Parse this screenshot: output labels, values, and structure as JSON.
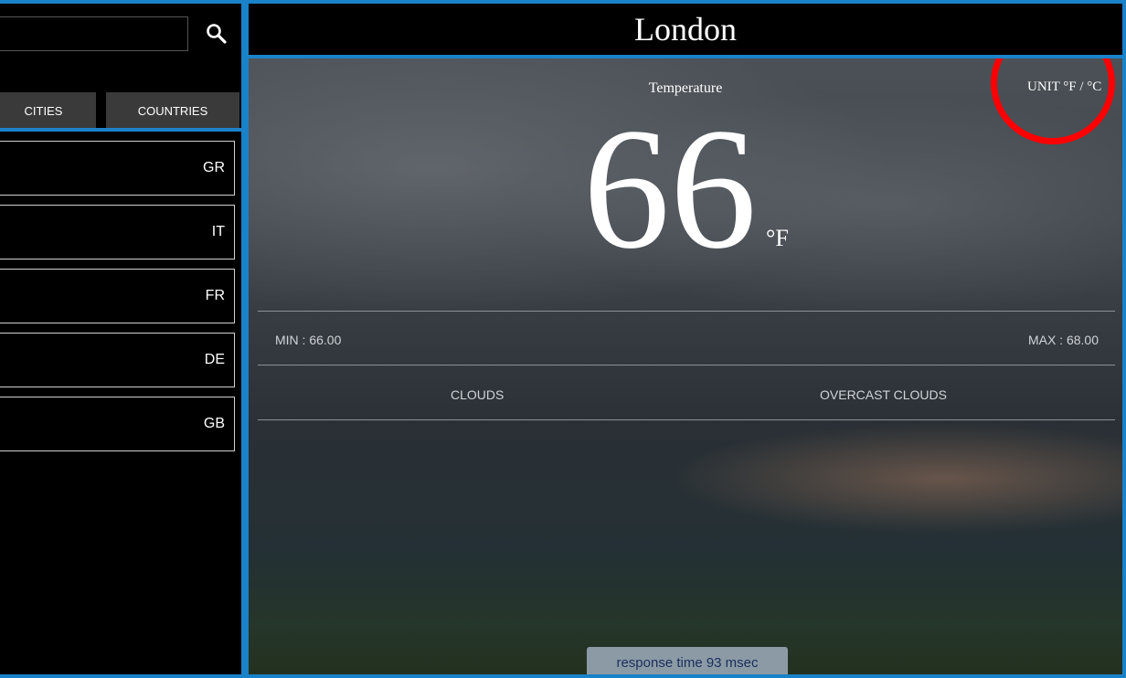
{
  "search": {
    "placeholder": "",
    "value": "",
    "icon": "search-icon"
  },
  "tabs": [
    {
      "label": "CITIES"
    },
    {
      "label": "COUNTRIES"
    }
  ],
  "countries": [
    {
      "code": "GR"
    },
    {
      "code": "IT"
    },
    {
      "code": "FR"
    },
    {
      "code": "DE"
    },
    {
      "code": "GB"
    }
  ],
  "header": {
    "city": "London"
  },
  "weather": {
    "temperature_label": "Temperature",
    "temperature": "66",
    "unit_symbol": "°F",
    "unit_toggle": "UNIT °F / °C",
    "min": "MIN : 66.00",
    "max": "MAX : 68.00",
    "condition_main": "CLOUDS",
    "condition_desc": "OVERCAST CLOUDS"
  },
  "footer": {
    "response_time": "response time 93 msec"
  },
  "colors": {
    "border": "#1a82c8",
    "highlight": "#ff0000",
    "background": "#000000"
  }
}
